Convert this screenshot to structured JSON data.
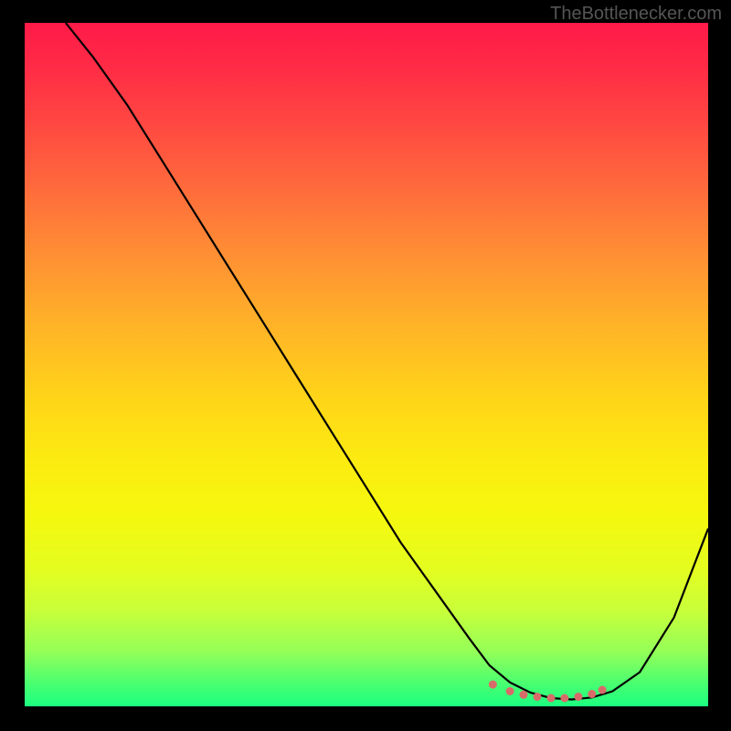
{
  "watermark": "TheBottlenecker.com",
  "chart_data": {
    "type": "line",
    "title": "",
    "xlabel": "",
    "ylabel": "",
    "xlim": [
      0,
      100
    ],
    "ylim": [
      0,
      100
    ],
    "series": [
      {
        "name": "curve",
        "x": [
          6,
          10,
          15,
          20,
          25,
          30,
          35,
          40,
          45,
          50,
          55,
          60,
          65,
          68,
          71,
          74,
          77,
          80,
          83,
          86,
          90,
          95,
          100
        ],
        "y": [
          100,
          95,
          88,
          80,
          72,
          64,
          56,
          48,
          40,
          32,
          24,
          17,
          10,
          6,
          3.5,
          2,
          1.2,
          1,
          1.3,
          2.2,
          5,
          13,
          26
        ]
      }
    ],
    "highlight_points": {
      "name": "optimal-range-dots",
      "color": "#d96a6a",
      "x": [
        68.5,
        71,
        73,
        75,
        77,
        79,
        81,
        83,
        84.5
      ],
      "y": [
        3.2,
        2.2,
        1.7,
        1.4,
        1.2,
        1.2,
        1.4,
        1.8,
        2.4
      ]
    },
    "gradient_description": "vertical red-to-green heat gradient, red at top (high bottleneck), green at bottom (no bottleneck)"
  }
}
